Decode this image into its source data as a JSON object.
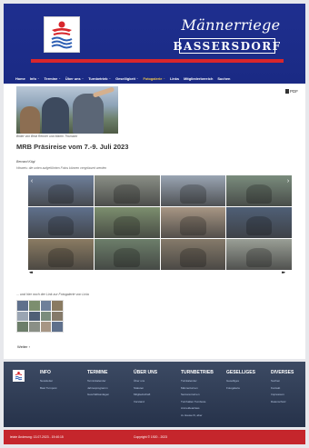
{
  "header": {
    "brand_script": "Männerriege",
    "brand_block": "BASSERSDORF",
    "nav": [
      {
        "label": "Home",
        "dropdown": false,
        "active": false
      },
      {
        "label": "Info",
        "dropdown": true,
        "active": false
      },
      {
        "label": "Termine",
        "dropdown": true,
        "active": false
      },
      {
        "label": "Über uns",
        "dropdown": true,
        "active": false
      },
      {
        "label": "Turnbetrieb",
        "dropdown": true,
        "active": false
      },
      {
        "label": "Geselligkeit",
        "dropdown": true,
        "active": false
      },
      {
        "label": "Fotogalerie",
        "dropdown": true,
        "active": true
      },
      {
        "label": "Links",
        "dropdown": false,
        "active": false
      },
      {
        "label": "Mitgliederbereich",
        "dropdown": false,
        "active": false
      },
      {
        "label": "Suchen",
        "dropdown": false,
        "active": false
      }
    ]
  },
  "content": {
    "pdf_label": "PDF",
    "hero_caption": "Bilder von Beat Renner und Martin Thomann",
    "title": "MRB Präsireise vom 7.-9. Juli 2023",
    "author": "Bernard Kägi",
    "note": "Hinweis: die unten aufgeführten Fotos können vergrössert werden",
    "gallery_nav_left": "◂◂",
    "gallery_nav_right": "▸▸",
    "link_text": "... und hier noch der Link zur Fotogalerie von Livia",
    "weiter_label": "Weiter ›",
    "thumb_colors": [
      "#6e7f9a",
      "#8a8f86",
      "#9aa5b3",
      "#7a8c7d",
      "#5f708c",
      "#7c8e6e",
      "#a79684",
      "#4f5f76",
      "#8a7b62",
      "#6c7e6a",
      "#857a6a",
      "#9a9f96"
    ],
    "small_thumb_colors": [
      "#5f708c",
      "#7c8e6e",
      "#6e7f9a",
      "#8a7b62",
      "#9aa5b3",
      "#4f5f76",
      "#7a8c7d",
      "#857a6a",
      "#6c7e6a",
      "#8a8f86",
      "#a79684",
      "#5f708c"
    ]
  },
  "footer": {
    "columns": [
      {
        "head": "INFO",
        "links": [
          "Newsletter",
          "Bast Turnpost"
        ]
      },
      {
        "head": "TERMINE",
        "links": [
          "Terminkalender",
          "Jahresprogramm",
          "Geschäftsanlagen"
        ]
      },
      {
        "head": "ÜBER UNS",
        "links": [
          "Über uns",
          "Statuten",
          "Mitgliedschaft",
          "Vorstand"
        ]
      },
      {
        "head": "TURNBETRIEB",
        "links": [
          "Turnkalender",
          "Männerturnen",
          "Seniorenturnen",
          "Turnhallen Turnfeste",
          "Anmeldeanlass",
          "zu Hause fit, aber"
        ]
      },
      {
        "head": "GESELLIGES",
        "links": [
          "Geselliges",
          "Fotogalerie"
        ]
      },
      {
        "head": "DIVERSES",
        "links": [
          "Suchen",
          "Kontakt",
          "Impressum",
          "Datenschutz"
        ]
      }
    ],
    "last_change": "letzte Änderung: 13.07.2023 - 19:40:15",
    "copyright": "Copyright © 1920 - 2023"
  },
  "colors": {
    "header_blue": "#1f2f8f",
    "accent_red": "#d8262c",
    "active_nav": "#f2c94c",
    "footer_bg": "#2e3b55"
  }
}
